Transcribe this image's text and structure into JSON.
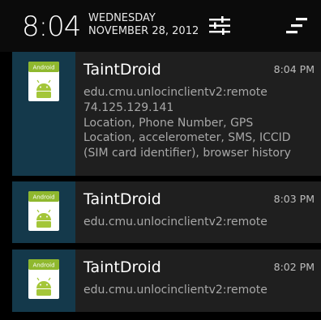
{
  "header": {
    "clock": "8:04",
    "day": "WEDNESDAY",
    "date": "NOVEMBER 28, 2012"
  },
  "icons": {
    "settings": "quick-settings-sliders-icon",
    "clear": "clear-all-icon",
    "app": "android-app-icon"
  },
  "notifications": [
    {
      "title": "TaintDroid",
      "time": "8:04 PM",
      "lines": [
        "edu.cmu.unlocinclientv2:remote",
        "74.125.129.141",
        "Location, Phone Number, GPS",
        "Location, accelerometer, SMS, ICCID",
        "(SIM card identifier), browser history"
      ]
    },
    {
      "title": "TaintDroid",
      "time": "8:03 PM",
      "lines": [
        "edu.cmu.unlocinclientv2:remote"
      ]
    },
    {
      "title": "TaintDroid",
      "time": "8:02 PM",
      "lines": [
        "edu.cmu.unlocinclientv2:remote"
      ]
    }
  ],
  "app_icon_label": "Android",
  "colors": {
    "header_bg": "#0b0b0b",
    "notification_bg": "#1f1f1f",
    "icon_tile_bg": "#14394b",
    "android_green": "#a4c639"
  }
}
